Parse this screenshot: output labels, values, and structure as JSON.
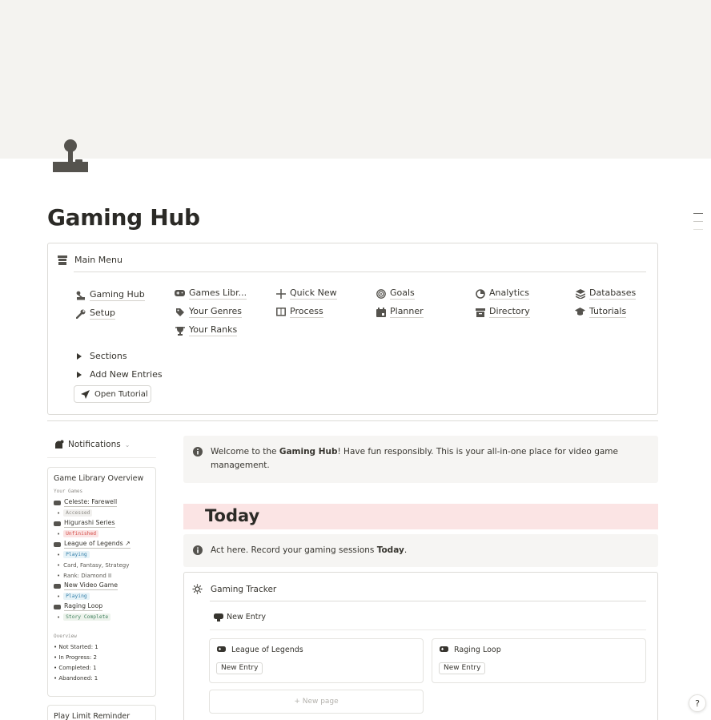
{
  "page": {
    "title": "Gaming Hub"
  },
  "main_menu": {
    "title": "Main Menu",
    "links": [
      {
        "label": "Gaming Hub",
        "icon": "joystick-icon"
      },
      {
        "label": "Setup",
        "icon": "wrench-icon"
      },
      {
        "label": "Games Libr...",
        "icon": "gamepad-icon"
      },
      {
        "label": "Your Genres",
        "icon": "tag-icon"
      },
      {
        "label": "Your Ranks",
        "icon": "trophy-icon"
      },
      {
        "label": "Quick New",
        "icon": "plus-icon"
      },
      {
        "label": "Process",
        "icon": "book-icon"
      },
      {
        "label": "Goals",
        "icon": "target-icon"
      },
      {
        "label": "Planner",
        "icon": "calendar-icon"
      },
      {
        "label": "Analytics",
        "icon": "pie-chart-icon"
      },
      {
        "label": "Directory",
        "icon": "archive-icon"
      },
      {
        "label": "Databases",
        "icon": "layers-icon"
      },
      {
        "label": "Tutorials",
        "icon": "graduation-cap-icon"
      }
    ],
    "toggles": [
      {
        "label": "Sections"
      },
      {
        "label": "Add New Entries"
      }
    ],
    "tutorial_button": "Open Tutorial"
  },
  "notifications": {
    "label": "Notifications"
  },
  "library_overview": {
    "title": "Game Library Overview",
    "your_games_label": "Your Games",
    "games": [
      {
        "name": "Celeste: Farewell",
        "tags": [
          {
            "text": "Accessed",
            "style": "acc"
          }
        ]
      },
      {
        "name": "Higurashi Series",
        "tags": [
          {
            "text": "Unfinished",
            "style": "unf"
          }
        ]
      },
      {
        "name": "League of Legends ↗",
        "tags": [
          {
            "text": "Playing",
            "style": "ply"
          }
        ],
        "details": [
          "Card, Fantasy, Strategy",
          "Rank: Diamond II"
        ]
      },
      {
        "name": "New Video Game",
        "tags": [
          {
            "text": "Playing",
            "style": "ply"
          }
        ]
      },
      {
        "name": "Raging Loop",
        "tags": [
          {
            "text": "Story Complete",
            "style": "sc"
          }
        ]
      }
    ],
    "overview_label": "Overview",
    "overview": [
      "• Not Started: 1",
      "• In Progress: 2",
      "• Completed: 1",
      "• Abandoned: 1"
    ]
  },
  "play_limit": {
    "title": "Play Limit Reminder"
  },
  "welcome_callout": {
    "pre": "Welcome to the ",
    "bold": "Gaming Hub",
    "post": "! Have fun responsibly. This is your all-in-one place for video game management."
  },
  "today": {
    "heading": "Today",
    "callout_pre": "Act here. Record your gaming sessions ",
    "callout_bold": "Today",
    "callout_post": "."
  },
  "tracker": {
    "title": "Gaming Tracker",
    "new_entry_label": "New Entry",
    "cards": [
      {
        "title": "League of Legends",
        "button": "New Entry"
      },
      {
        "title": "Raging Loop",
        "button": "New Entry"
      }
    ],
    "new_page_label": "+   New page"
  },
  "help_button": "?"
}
